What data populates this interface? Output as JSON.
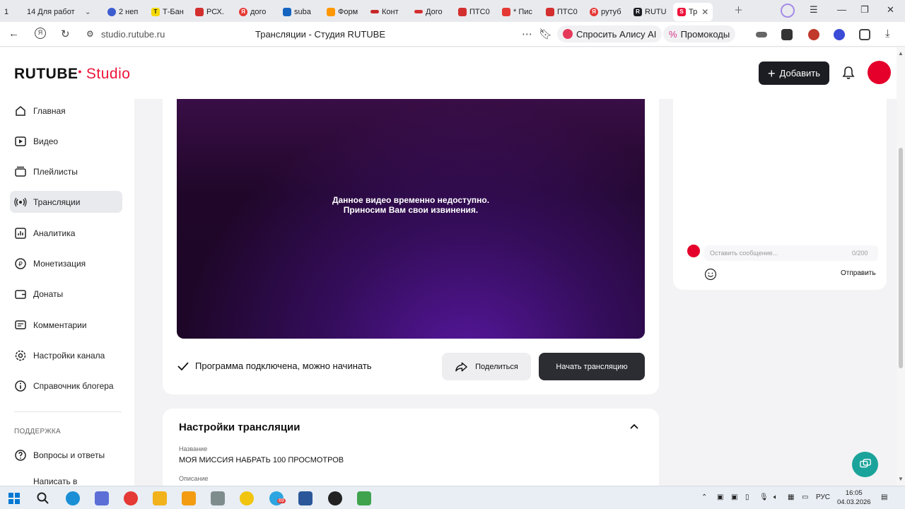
{
  "browser": {
    "tabs": [
      {
        "label": "1",
        "color": "#888888"
      },
      {
        "label": "14 Для работ",
        "color": "#555555"
      },
      {
        "label": "2 неп",
        "color": "#3c5ccf"
      },
      {
        "label": "Т-Бан",
        "color": "#f5d900"
      },
      {
        "label": "РСХ.",
        "color": "#d32f2f"
      },
      {
        "label": "дого",
        "color": "#e53935"
      },
      {
        "label": "subа",
        "color": "#1565c0"
      },
      {
        "label": "Форм",
        "color": "#ff9800"
      },
      {
        "label": "Конт",
        "color": "#c62828"
      },
      {
        "label": "Дого",
        "color": "#d32f2f"
      },
      {
        "label": "ПТС0",
        "color": "#d32f2f"
      },
      {
        "label": "* Пис",
        "color": "#e53935"
      },
      {
        "label": "ПТС0",
        "color": "#d32f2f"
      },
      {
        "label": "рутуб",
        "color": "#e53935"
      },
      {
        "label": "RUTU",
        "color": "#1c1d22"
      },
      {
        "label": "Тр",
        "color": "#ed143b",
        "active": true
      }
    ],
    "url": "studio.rutube.ru",
    "page_title": "Трансляции - Студия RUTUBE",
    "alice_label": "Спросить Алису AI",
    "promo_label": "Промокоды"
  },
  "header": {
    "logo_main": "RUTUBE",
    "logo_studio": "Studio",
    "add_button": "Добавить"
  },
  "sidebar": {
    "items": [
      {
        "label": "Главная",
        "icon": "home-icon"
      },
      {
        "label": "Видео",
        "icon": "video-icon"
      },
      {
        "label": "Плейлисты",
        "icon": "playlist-icon"
      },
      {
        "label": "Трансляции",
        "icon": "broadcast-icon",
        "active": true
      },
      {
        "label": "Аналитика",
        "icon": "analytics-icon"
      },
      {
        "label": "Монетизация",
        "icon": "ruble-icon"
      },
      {
        "label": "Донаты",
        "icon": "wallet-icon"
      },
      {
        "label": "Комментарии",
        "icon": "comment-icon"
      },
      {
        "label": "Настройки канала",
        "icon": "gear-icon"
      },
      {
        "label": "Справочник блогера",
        "icon": "info-icon"
      }
    ],
    "support_title": "ПОДДЕРЖКА",
    "support_items": [
      {
        "label": "Вопросы и ответы",
        "icon": "help-icon"
      },
      {
        "label": "Написать в",
        "icon": "chat-icon"
      }
    ]
  },
  "player": {
    "message_line1": "Данное видео временно недоступно.",
    "message_line2": "Приносим Вам свои извинения."
  },
  "stream": {
    "status_text": "Программа подключена, можно начинать",
    "share_button": "Поделиться",
    "start_button": "Начать трансляцию"
  },
  "chat": {
    "placeholder": "Оставить сообщение...",
    "counter": "0/200",
    "send_label": "Отправить"
  },
  "settings": {
    "title": "Настройки трансляции",
    "name_label": "Название",
    "name_value": "МОЯ МИССИЯ НАБРАТЬ 100 ПРОСМОТРОВ",
    "description_label": "Описание"
  },
  "taskbar": {
    "language": "РУС",
    "time": "16:05",
    "date": "04.03.2026",
    "telegram_badge": "69"
  }
}
